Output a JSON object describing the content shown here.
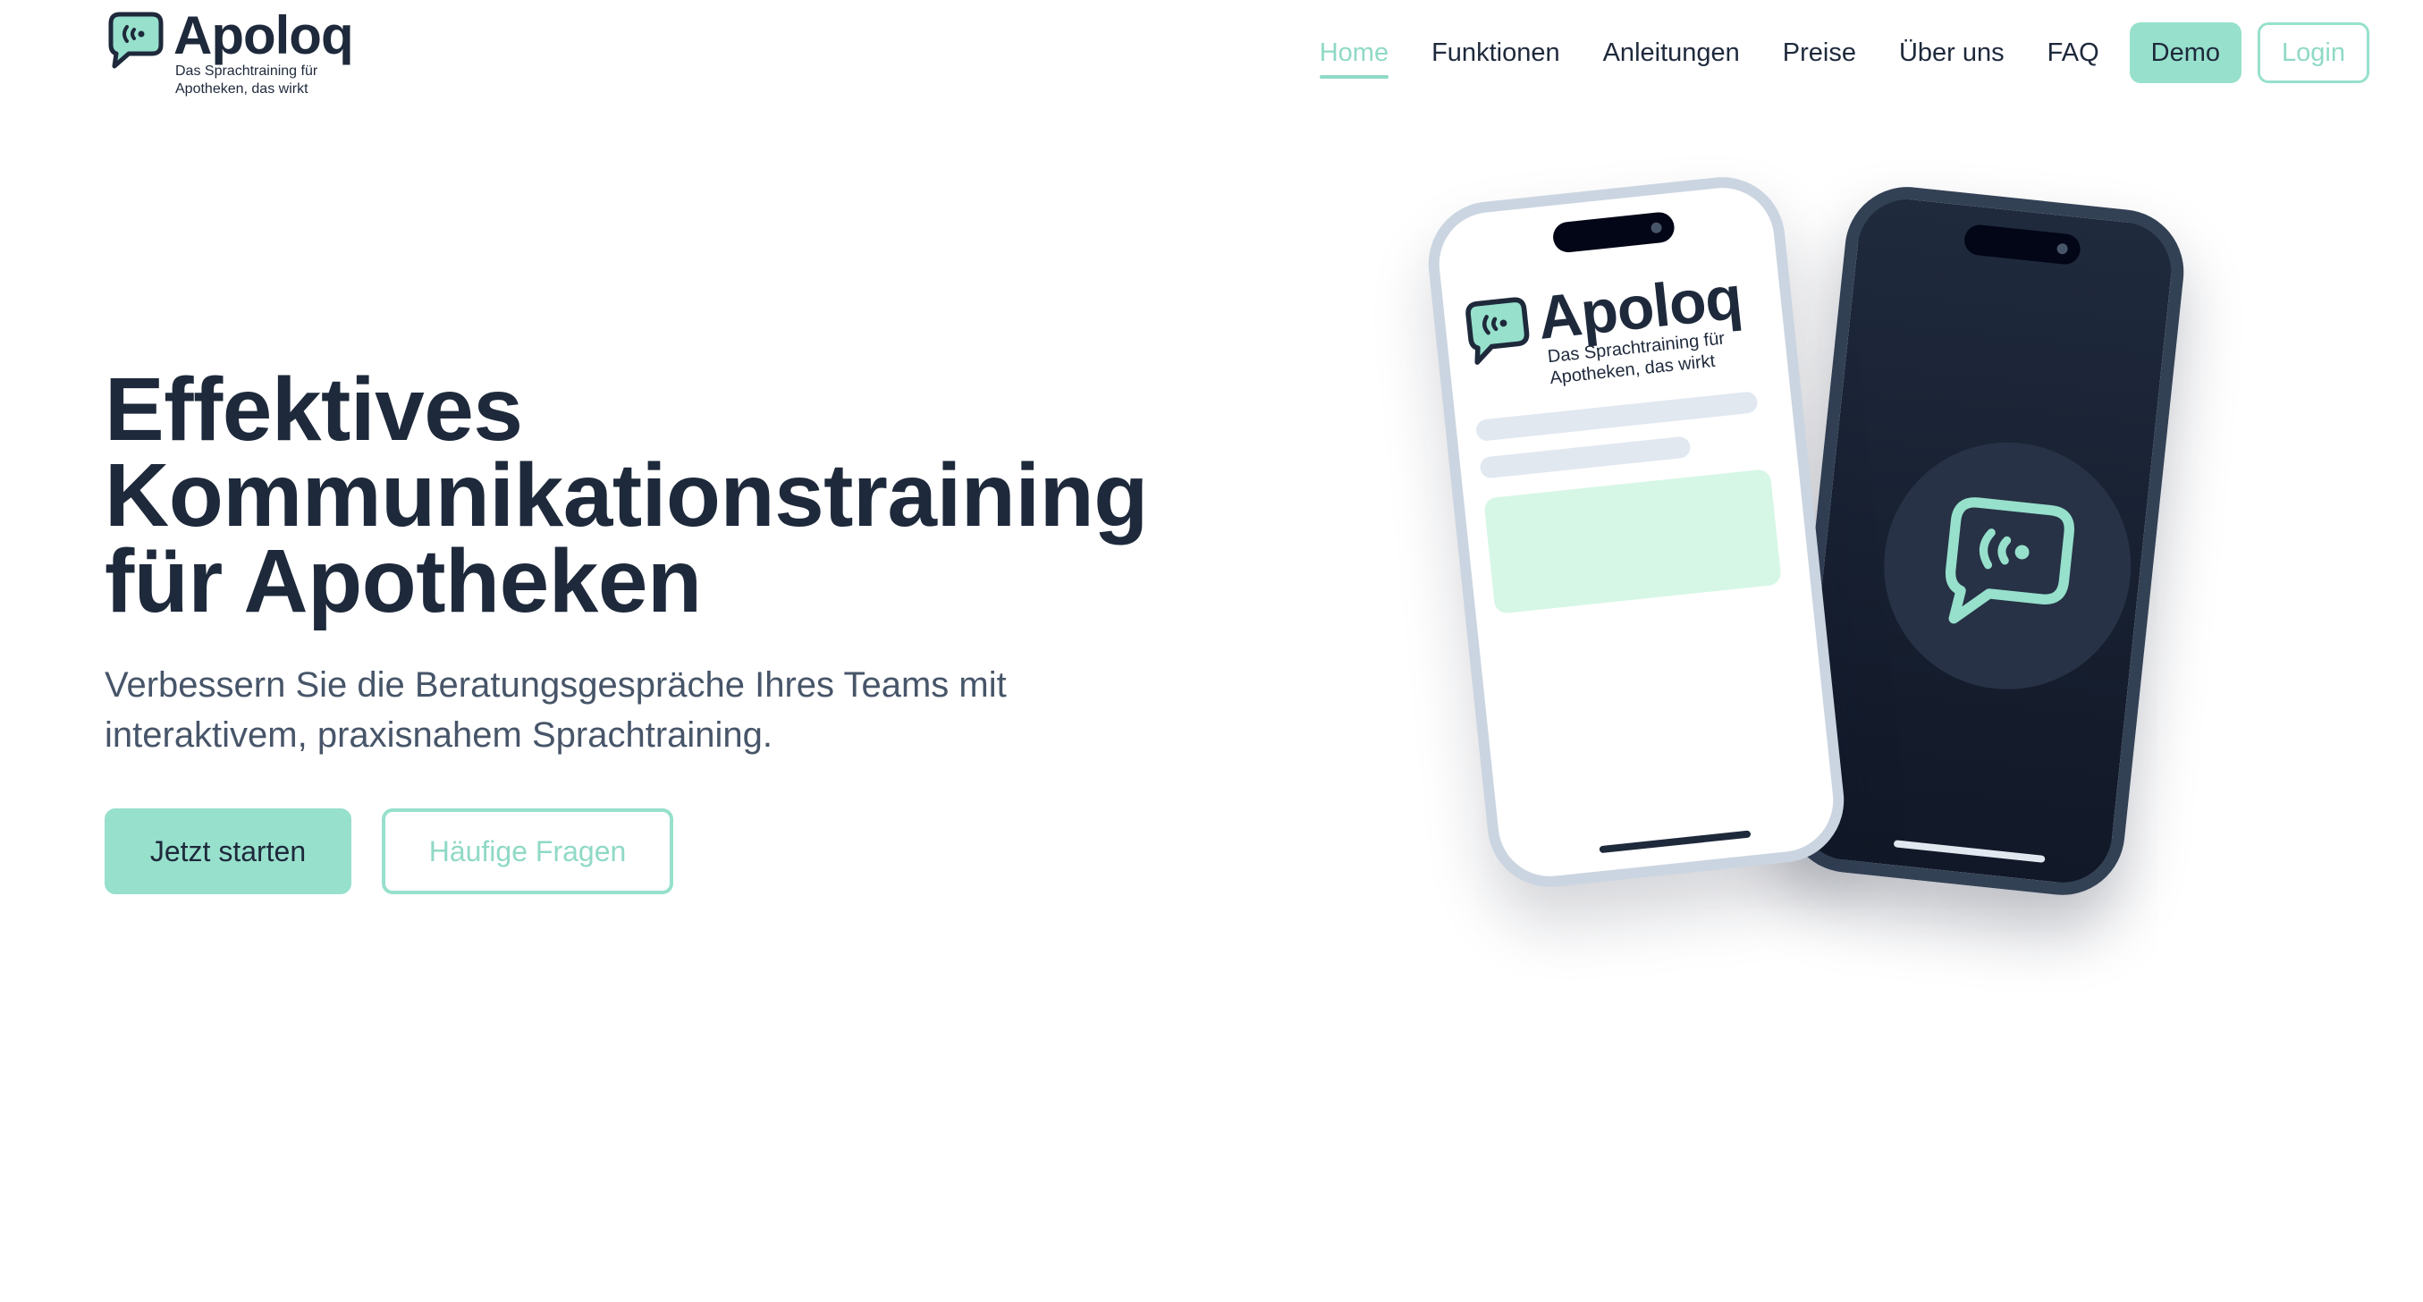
{
  "brand": {
    "name": "Apoloq",
    "tagline_line1": "Das Sprachtraining für",
    "tagline_line2": "Apotheken, das wirkt",
    "colors": {
      "accent": "#97e0cc",
      "text": "#1e293b",
      "muted": "#475569"
    }
  },
  "nav": {
    "items": [
      {
        "label": "Home",
        "active": true
      },
      {
        "label": "Funktionen",
        "active": false
      },
      {
        "label": "Anleitungen",
        "active": false
      },
      {
        "label": "Preise",
        "active": false
      },
      {
        "label": "Über uns",
        "active": false
      },
      {
        "label": "FAQ",
        "active": false
      }
    ],
    "demo_label": "Demo",
    "login_label": "Login"
  },
  "hero": {
    "title_line1": "Effektives",
    "title_line2": "Kommunikationstraining",
    "title_line3": "für Apotheken",
    "subtitle_line1": "Verbessern Sie die Beratungsgespräche Ihres Teams mit",
    "subtitle_line2": "interaktivem, praxisnahem Sprachtraining.",
    "primary_cta": "Jetzt starten",
    "secondary_cta": "Häufige Fragen"
  },
  "illustration": {
    "icons": [
      "speech-bubble-signal-icon"
    ]
  }
}
